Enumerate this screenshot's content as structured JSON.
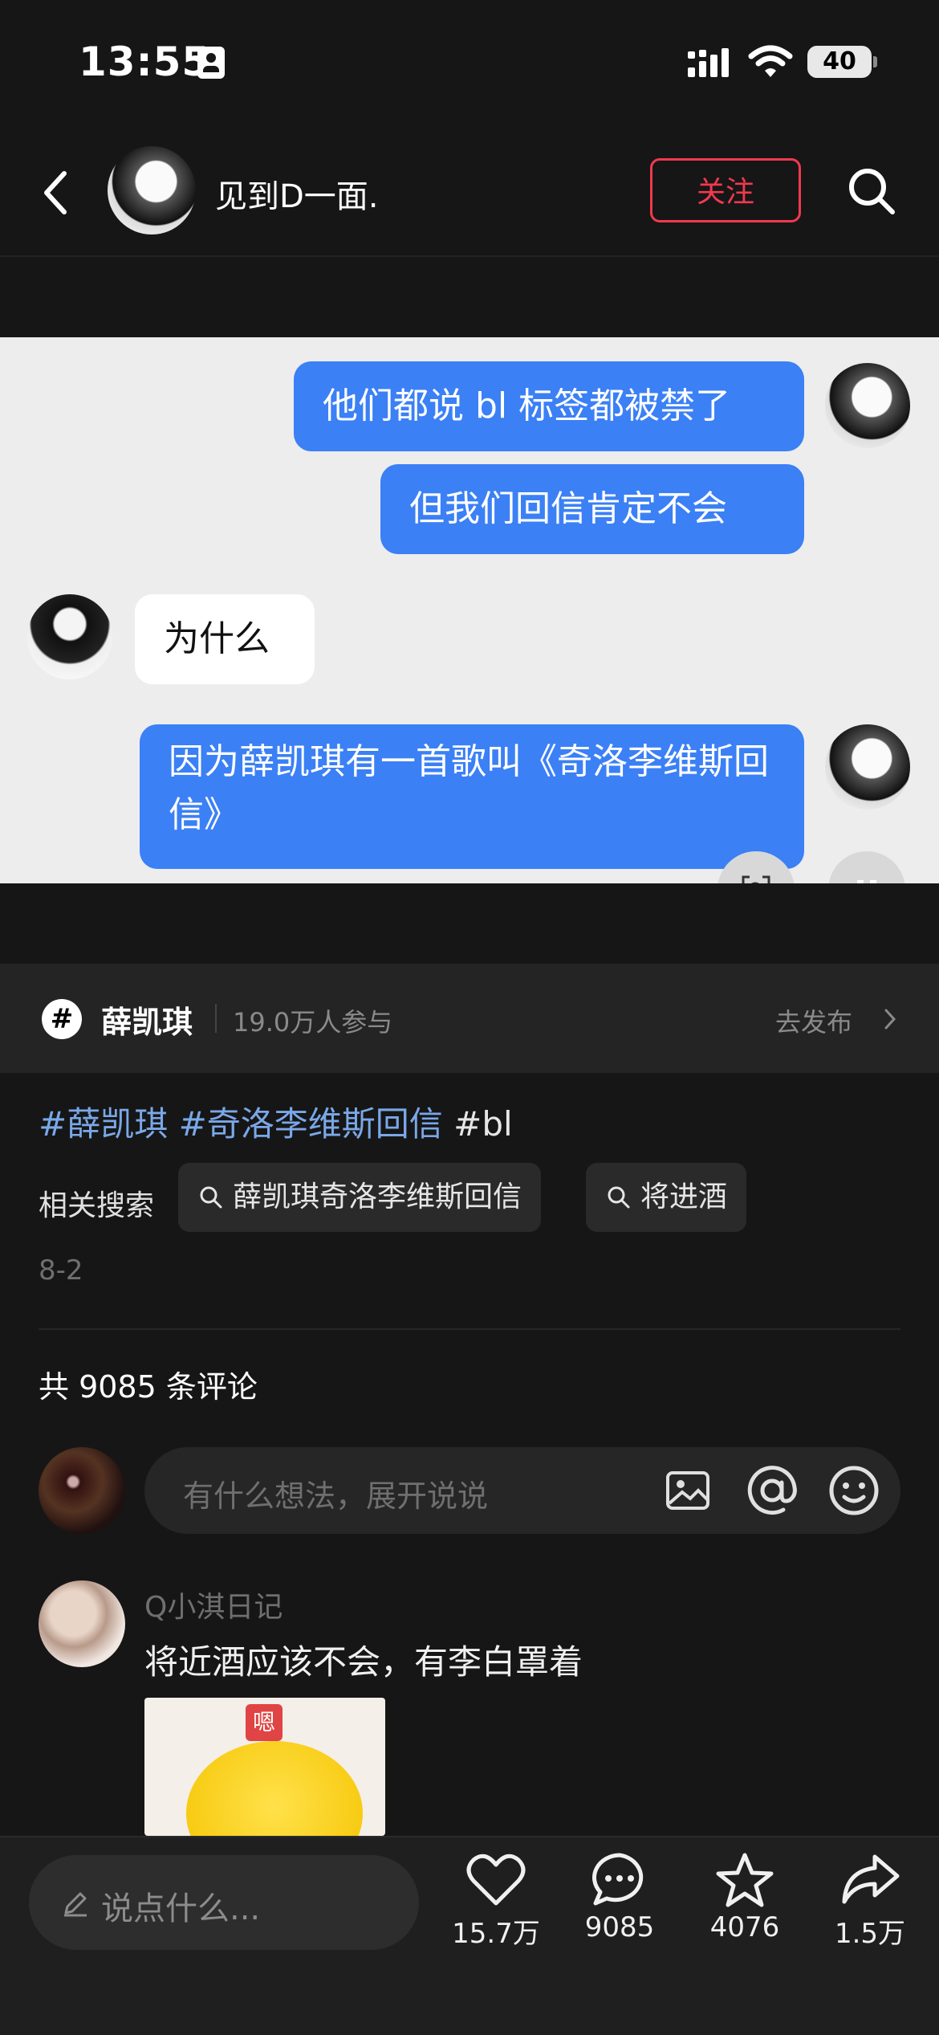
{
  "status_bar": {
    "time": "13:55",
    "battery": "40"
  },
  "header": {
    "title": "见到D一面.",
    "follow_label": "关注"
  },
  "chat": {
    "messages": [
      {
        "side": "right",
        "text": "他们都说 bl 标签都被禁了"
      },
      {
        "side": "right",
        "text": "但我们回信肯定不会"
      },
      {
        "side": "left",
        "text": "为什么"
      },
      {
        "side": "right",
        "text": "因为薛凯琪有一首歌叫《奇洛李维斯回信》"
      }
    ]
  },
  "topic": {
    "icon": "#",
    "name": "薛凯琪",
    "count": "19.0万人参与",
    "action": "去发布"
  },
  "tags": {
    "items": [
      "#薛凯琪",
      "#奇洛李维斯回信",
      "#bl"
    ]
  },
  "related": {
    "label": "相关搜索",
    "chips": [
      "薛凯琪奇洛李维斯回信",
      "将进酒"
    ]
  },
  "date": "8-2",
  "comments": {
    "count_text": "共 9085 条评论",
    "input_placeholder": "有什么想法，展开说说",
    "list": [
      {
        "user": "Q小淇日记",
        "text": "将近酒应该不会，有李白罩着",
        "image_badge": "嗯"
      }
    ]
  },
  "bottom_bar": {
    "say_placeholder": "说点什么...",
    "likes": "15.7万",
    "comments": "9085",
    "favorites": "4076",
    "shares": "1.5万"
  },
  "colors": {
    "accent_red": "#f2394f",
    "bubble_blue": "#3b80f5",
    "tag_blue": "#7aa8e8"
  }
}
